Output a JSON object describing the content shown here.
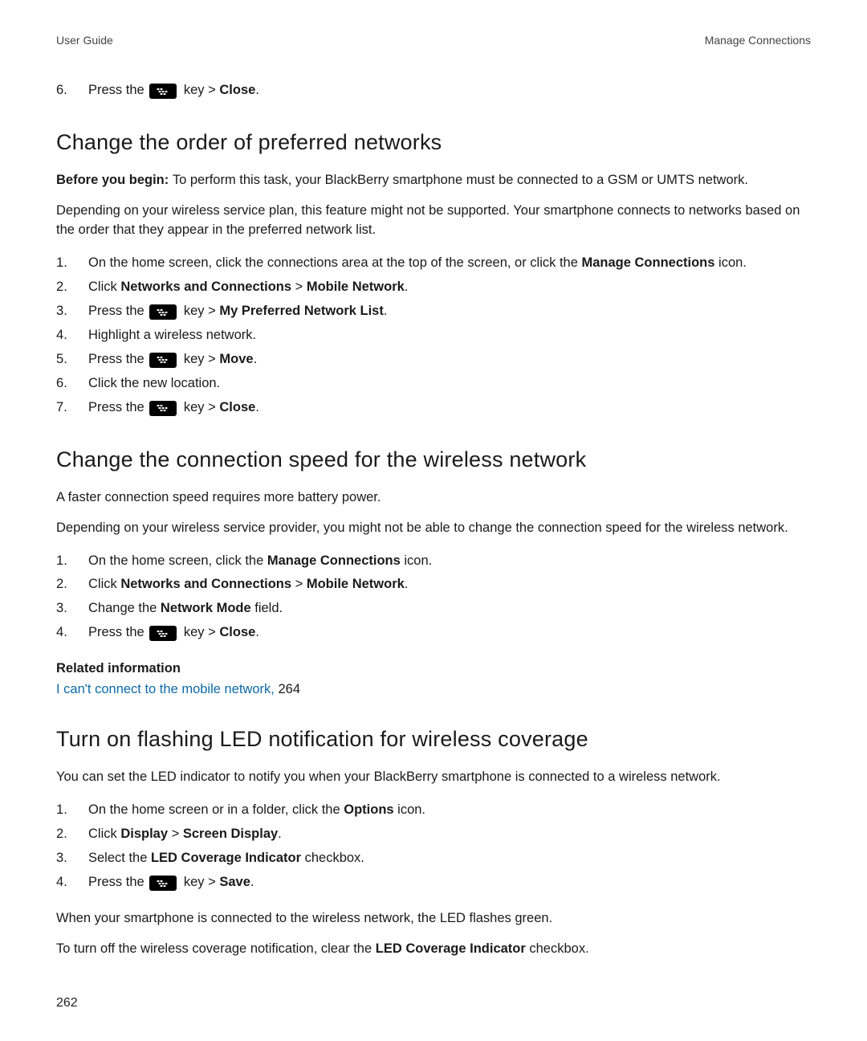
{
  "header": {
    "left": "User Guide",
    "right": "Manage Connections"
  },
  "intro_step": {
    "num": "6.",
    "pre": "Press the ",
    "post_key": " key > ",
    "action": "Close",
    "tail": "."
  },
  "s1": {
    "title": "Change the order of preferred networks",
    "before_label": "Before you begin: ",
    "before_text": "To perform this task, your BlackBerry smartphone must be connected to a GSM or UMTS network.",
    "note": "Depending on your wireless service plan, this feature might not be supported. Your smartphone connects to networks based on the order that they appear in the preferred network list.",
    "steps": {
      "s1": {
        "a": "On the home screen, click the connections area at the top of the screen, or click the ",
        "b": "Manage Connections",
        "c": " icon."
      },
      "s2": {
        "a": "Click ",
        "b": "Networks and Connections",
        "c": " > ",
        "d": "Mobile Network",
        "e": "."
      },
      "s3": {
        "a": "Press the ",
        "b": " key > ",
        "c": "My Preferred Network List",
        "d": "."
      },
      "s4": {
        "a": "Highlight a wireless network."
      },
      "s5": {
        "a": "Press the ",
        "b": " key > ",
        "c": "Move",
        "d": "."
      },
      "s6": {
        "a": "Click the new location."
      },
      "s7": {
        "a": "Press the ",
        "b": " key > ",
        "c": "Close",
        "d": "."
      }
    }
  },
  "s2": {
    "title": "Change the connection speed for the wireless network",
    "p1": "A faster connection speed requires more battery power.",
    "p2": "Depending on your wireless service provider, you might not be able to change the connection speed for the wireless network.",
    "steps": {
      "s1": {
        "a": "On the home screen, click the ",
        "b": "Manage Connections",
        "c": " icon."
      },
      "s2": {
        "a": "Click ",
        "b": "Networks and Connections",
        "c": " > ",
        "d": "Mobile Network",
        "e": "."
      },
      "s3": {
        "a": "Change the ",
        "b": "Network Mode",
        "c": " field."
      },
      "s4": {
        "a": "Press the ",
        "b": " key > ",
        "c": "Close",
        "d": "."
      }
    },
    "related_hdr": "Related information",
    "related_link": "I can't connect to the mobile network, ",
    "related_page": "264"
  },
  "s3": {
    "title": "Turn on flashing LED notification for wireless coverage",
    "p1": "You can set the LED indicator to notify you when your BlackBerry smartphone is connected to a wireless network.",
    "steps": {
      "s1": {
        "a": "On the home screen or in a folder, click the ",
        "b": "Options",
        "c": " icon."
      },
      "s2": {
        "a": "Click ",
        "b": "Display",
        "c": " > ",
        "d": "Screen Display",
        "e": "."
      },
      "s3": {
        "a": "Select the ",
        "b": "LED Coverage Indicator",
        "c": " checkbox."
      },
      "s4": {
        "a": "Press the ",
        "b": " key > ",
        "c": "Save",
        "d": "."
      }
    },
    "p2": "When your smartphone is connected to the wireless network, the LED flashes green.",
    "p3a": "To turn off the wireless coverage notification, clear the ",
    "p3b": "LED Coverage Indicator",
    "p3c": " checkbox."
  },
  "page_number": "262"
}
